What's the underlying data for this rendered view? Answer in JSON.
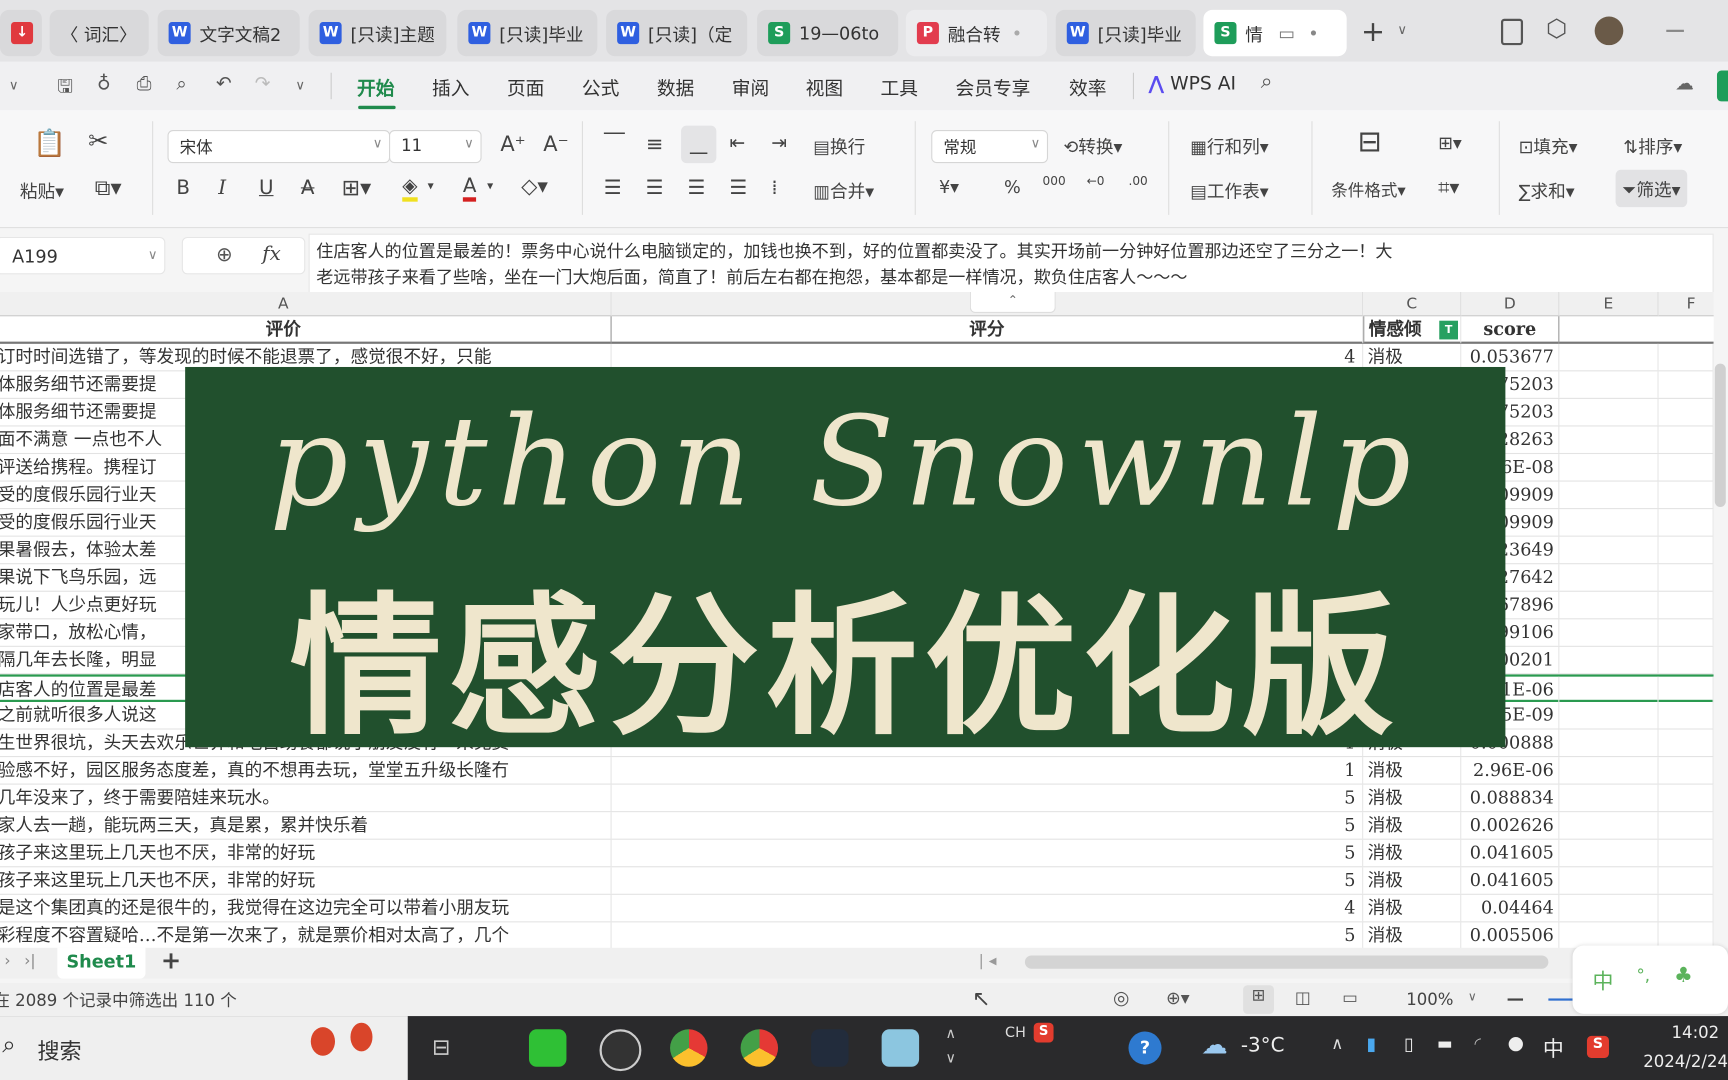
{
  "tabs": [
    {
      "icon": "pdf-icon",
      "label": ""
    },
    {
      "icon": "back-icon",
      "label": "〈 词汇〉"
    },
    {
      "icon": "W",
      "label": "文字文稿2"
    },
    {
      "icon": "W",
      "label": "[只读]主题"
    },
    {
      "icon": "W",
      "label": "[只读]毕业"
    },
    {
      "icon": "W",
      "label": "[只读]（定"
    },
    {
      "icon": "S",
      "label": "19—06to"
    },
    {
      "icon": "P",
      "label": "融合转"
    },
    {
      "icon": "W",
      "label": "[只读]毕业"
    },
    {
      "icon": "S",
      "label": "情"
    }
  ],
  "tab_new": "+",
  "menu": [
    "开始",
    "插入",
    "页面",
    "公式",
    "数据",
    "审阅",
    "视图",
    "工具",
    "会员专享",
    "效率"
  ],
  "wps_ai": "WPS AI",
  "ribbon": {
    "paste": "粘贴▾",
    "font_name": "宋体",
    "font_size": "11",
    "grow": "A⁺",
    "shrink": "A⁻",
    "bold": "B",
    "italic": "I",
    "underline": "U",
    "strike": "A",
    "wrap": "换行",
    "merge": "合并▾",
    "number_format": "常规",
    "convert": "转换▾",
    "currency": "¥▾",
    "percent": "%",
    "thousands": "000",
    "inc_dec": "←0",
    "dec_dec": ".00",
    "rows_cols": "行和列▾",
    "worksheet": "工作表▾",
    "cond_format": "条件格式▾",
    "fill": "填充▾",
    "sort": "排序▾",
    "sum": "求和▾",
    "filter": "筛选▾"
  },
  "formula": {
    "cell_ref": "A199",
    "fx": "fx",
    "content_line1": "住店客人的位置是最差的！票务中心说什么电脑锁定的，加钱也换不到，好的位置都卖没了。其实开场前一分钟好位置那边还空了三分之一！大",
    "content_line2": "老远带孩子来看了些啥，坐在一门大炮后面，简直了！前后左右都在抱怨，基本都是一样情况，欺负住店客人～～～"
  },
  "columns": [
    "A",
    "B",
    "C",
    "D",
    "E",
    "F"
  ],
  "header_row": {
    "a": "评价",
    "b": "评分",
    "c": "情感倾",
    "d": "score"
  },
  "rows": [
    {
      "a": "订时时间选错了，等发现的时候不能退票了，感觉很不好，只能",
      "b": "4",
      "c": "消极",
      "d": "0.053677"
    },
    {
      "a": "体服务细节还需要提",
      "b": "",
      "c": "",
      "d": "75203"
    },
    {
      "a": "体服务细节还需要提",
      "b": "",
      "c": "",
      "d": "75203"
    },
    {
      "a": "面不满意 一点也不人",
      "b": "",
      "c": "",
      "d": "28263"
    },
    {
      "a": "评送给携程。携程订",
      "b": "",
      "c": "",
      "d": "6E-08"
    },
    {
      "a": "受的度假乐园行业天",
      "b": "",
      "c": "",
      "d": "09909"
    },
    {
      "a": "受的度假乐园行业天",
      "b": "",
      "c": "",
      "d": "09909"
    },
    {
      "a": "果暑假去，体验太差",
      "b": "",
      "c": "",
      "d": "23649"
    },
    {
      "a": "果说下飞鸟乐园，远",
      "b": "",
      "c": "",
      "d": "27642"
    },
    {
      "a": "玩儿！人少点更好玩",
      "b": "",
      "c": "",
      "d": "67896"
    },
    {
      "a": "家带口，放松心情，",
      "b": "",
      "c": "",
      "d": "99106"
    },
    {
      "a": "隔几年去长隆，明显",
      "b": "",
      "c": "",
      "d": "00201"
    },
    {
      "a": "店客人的位置是最差",
      "b": "",
      "c": "",
      "d": "1E-06"
    },
    {
      "a": "之前就听很多人说这",
      "b": "",
      "c": "",
      "d": "5E-09"
    },
    {
      "a": "生世界很坑，头天去欢乐世界和吃自助餐都说小朋友没有一米免费",
      "b": "1",
      "c": "消极",
      "d": "0.000888"
    },
    {
      "a": "验感不好，园区服务态度差，真的不想再去玩，堂堂五升级长隆冇",
      "b": "1",
      "c": "消极",
      "d": "2.96E-06"
    },
    {
      "a": "几年没来了，终于需要陪娃来玩水。",
      "b": "5",
      "c": "消极",
      "d": "0.088834"
    },
    {
      "a": "家人去一趟，能玩两三天，真是累，累并快乐着",
      "b": "5",
      "c": "消极",
      "d": "0.002626"
    },
    {
      "a": "孩子来这里玩上几天也不厌，非常的好玩",
      "b": "5",
      "c": "消极",
      "d": "0.041605"
    },
    {
      "a": "孩子来这里玩上几天也不厌，非常的好玩",
      "b": "5",
      "c": "消极",
      "d": "0.041605"
    },
    {
      "a": "是这个集团真的还是很牛的，我觉得在这边完全可以带着小朋友玩",
      "b": "4",
      "c": "消极",
      "d": "0.04464"
    },
    {
      "a": "彩程度不容置疑哈…不是第一次来了，就是票价相对太高了，几个",
      "b": "5",
      "c": "消极",
      "d": "0.005506"
    }
  ],
  "overlay": {
    "line1": "python Snownlp",
    "line2": "情感分析优化版"
  },
  "sheet_tab": "Sheet1",
  "add_sheet": "+",
  "status": {
    "filter_text": "在 2089 个记录中筛选出 110 个",
    "zoom": "100%"
  },
  "ime": {
    "label": "中",
    "punct": "°,"
  },
  "taskbar": {
    "search": "搜索",
    "lang": "CH",
    "weather": "-3°C",
    "ime": "中",
    "time": "14:02",
    "date": "2024/2/24"
  }
}
